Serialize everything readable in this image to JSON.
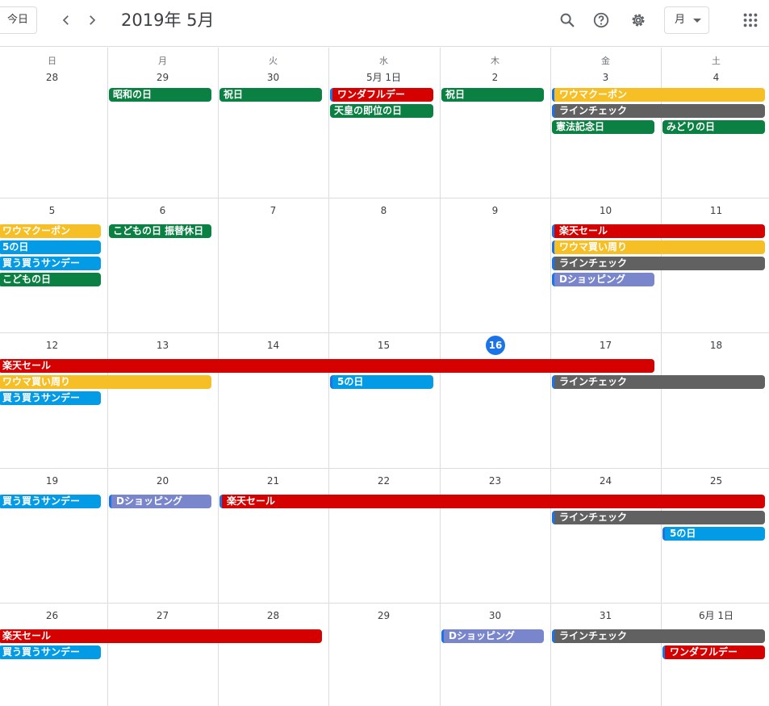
{
  "header": {
    "today_label": "今日",
    "title": "2019年 5月",
    "view_label": "月",
    "icons": [
      "chevron-left-icon",
      "chevron-right-icon",
      "search-icon",
      "help-icon",
      "settings-icon",
      "apps-grid-icon"
    ]
  },
  "weekdays": [
    "日",
    "月",
    "火",
    "水",
    "木",
    "金",
    "土"
  ],
  "weeks": [
    [
      "28",
      "29",
      "30",
      "5月 1日",
      "2",
      "3",
      "4"
    ],
    [
      "5",
      "6",
      "7",
      "8",
      "9",
      "10",
      "11"
    ],
    [
      "12",
      "13",
      "14",
      "15",
      "16",
      "17",
      "18"
    ],
    [
      "19",
      "20",
      "21",
      "22",
      "23",
      "24",
      "25"
    ],
    [
      "26",
      "27",
      "28",
      "29",
      "30",
      "31",
      "6月 1日"
    ]
  ],
  "today_day": "16",
  "colors": {
    "green": "#0b8043",
    "yellow": "#f6bf26",
    "gray": "#616161",
    "red": "#d50000",
    "blue": "#039be5",
    "lavender": "#7986cb",
    "today": "#1a73e8"
  },
  "events": [
    {
      "week": 0,
      "start": 1,
      "span": 1,
      "row": 0,
      "title": "昭和の日",
      "color": "green"
    },
    {
      "week": 0,
      "start": 2,
      "span": 1,
      "row": 0,
      "title": "祝日",
      "color": "green"
    },
    {
      "week": 0,
      "start": 3,
      "span": 1,
      "row": 0,
      "title": "ワンダフルデー",
      "color": "red",
      "cont": true
    },
    {
      "week": 0,
      "start": 3,
      "span": 1,
      "row": 1,
      "title": "天皇の即位の日",
      "color": "green"
    },
    {
      "week": 0,
      "start": 4,
      "span": 1,
      "row": 0,
      "title": "祝日",
      "color": "green"
    },
    {
      "week": 0,
      "start": 5,
      "span": 2,
      "row": 0,
      "title": "ワウマクーポン",
      "color": "yellow",
      "cont": true
    },
    {
      "week": 0,
      "start": 5,
      "span": 2,
      "row": 1,
      "title": "ラインチェック",
      "color": "gray",
      "cont": true
    },
    {
      "week": 0,
      "start": 5,
      "span": 1,
      "row": 2,
      "title": "憲法記念日",
      "color": "green"
    },
    {
      "week": 0,
      "start": 6,
      "span": 1,
      "row": 2,
      "title": "みどりの日",
      "color": "green"
    },
    {
      "week": 1,
      "start": 0,
      "span": 1,
      "row": 0,
      "title": "ワウマクーポン",
      "color": "yellow"
    },
    {
      "week": 1,
      "start": 0,
      "span": 1,
      "row": 1,
      "title": "5の日",
      "color": "blue"
    },
    {
      "week": 1,
      "start": 0,
      "span": 1,
      "row": 2,
      "title": "買う買うサンデー",
      "color": "blue"
    },
    {
      "week": 1,
      "start": 0,
      "span": 1,
      "row": 3,
      "title": "こどもの日",
      "color": "green"
    },
    {
      "week": 1,
      "start": 1,
      "span": 1,
      "row": 0,
      "title": "こどもの日 振替休日",
      "color": "green"
    },
    {
      "week": 1,
      "start": 5,
      "span": 2,
      "row": 0,
      "title": "楽天セール",
      "color": "red",
      "cont": true
    },
    {
      "week": 1,
      "start": 5,
      "span": 2,
      "row": 1,
      "title": "ワウマ買い周り",
      "color": "yellow",
      "cont": true
    },
    {
      "week": 1,
      "start": 5,
      "span": 2,
      "row": 2,
      "title": "ラインチェック",
      "color": "gray",
      "cont": true
    },
    {
      "week": 1,
      "start": 5,
      "span": 1,
      "row": 3,
      "title": "Dショッピング",
      "color": "lavender",
      "cont": true
    },
    {
      "week": 2,
      "start": 0,
      "span": 6,
      "row": 0,
      "title": "楽天セール",
      "color": "red"
    },
    {
      "week": 2,
      "start": 0,
      "span": 2,
      "row": 1,
      "title": "ワウマ買い周り",
      "color": "yellow"
    },
    {
      "week": 2,
      "start": 0,
      "span": 1,
      "row": 2,
      "title": "買う買うサンデー",
      "color": "blue"
    },
    {
      "week": 2,
      "start": 3,
      "span": 1,
      "row": 1,
      "title": "5の日",
      "color": "blue",
      "cont": true
    },
    {
      "week": 2,
      "start": 5,
      "span": 2,
      "row": 1,
      "title": "ラインチェック",
      "color": "gray",
      "cont": true
    },
    {
      "week": 3,
      "start": 0,
      "span": 1,
      "row": 0,
      "title": "買う買うサンデー",
      "color": "blue"
    },
    {
      "week": 3,
      "start": 1,
      "span": 1,
      "row": 0,
      "title": "Dショッピング",
      "color": "lavender",
      "cont": true
    },
    {
      "week": 3,
      "start": 2,
      "span": 5,
      "row": 0,
      "title": "楽天セール",
      "color": "red",
      "cont": true
    },
    {
      "week": 3,
      "start": 5,
      "span": 2,
      "row": 1,
      "title": "ラインチェック",
      "color": "gray",
      "cont": true
    },
    {
      "week": 3,
      "start": 6,
      "span": 1,
      "row": 2,
      "title": "5の日",
      "color": "blue",
      "cont": true
    },
    {
      "week": 4,
      "start": 0,
      "span": 3,
      "row": 0,
      "title": "楽天セール",
      "color": "red"
    },
    {
      "week": 4,
      "start": 0,
      "span": 1,
      "row": 1,
      "title": "買う買うサンデー",
      "color": "blue"
    },
    {
      "week": 4,
      "start": 4,
      "span": 1,
      "row": 0,
      "title": "Dショッピング",
      "color": "lavender",
      "cont": true
    },
    {
      "week": 4,
      "start": 5,
      "span": 2,
      "row": 0,
      "title": "ラインチェック",
      "color": "gray",
      "cont": true
    },
    {
      "week": 4,
      "start": 6,
      "span": 1,
      "row": 1,
      "title": "ワンダフルデー",
      "color": "red",
      "cont": true
    }
  ]
}
